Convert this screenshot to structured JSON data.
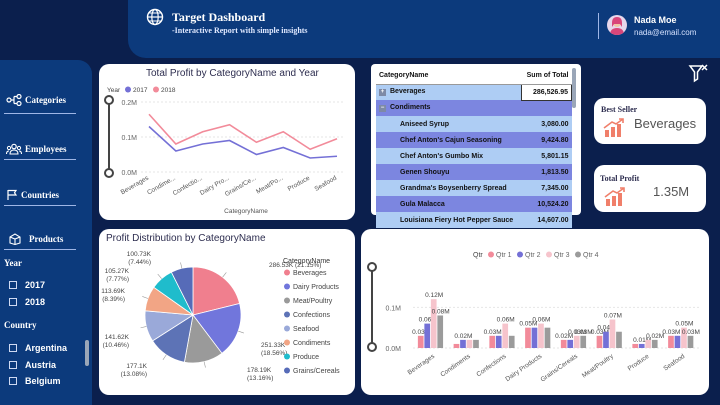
{
  "header": {
    "title": "Target Dashboard",
    "subtitle": "-Interactive Report with simple insights",
    "user_name": "Nada Moe",
    "user_email": "nada@email.com"
  },
  "sidebar": {
    "nav": [
      {
        "label": "Categories",
        "icon": "categories-icon"
      },
      {
        "label": "Employees",
        "icon": "employees-icon"
      },
      {
        "label": "Countries",
        "icon": "countries-icon"
      },
      {
        "label": "Products",
        "icon": "products-icon"
      }
    ],
    "year_label": "Year",
    "years": [
      "2017",
      "2018"
    ],
    "country_label": "Country",
    "countries": [
      "Argentina",
      "Austria",
      "Belgium"
    ]
  },
  "kpis": {
    "best_seller_label": "Best Seller",
    "best_seller_value": "Beverages",
    "total_profit_label": "Total Profit",
    "total_profit_value": "1.35M"
  },
  "matrix": {
    "col_category": "CategoryName",
    "col_total": "Sum of Total",
    "groups": [
      {
        "name": "Beverages",
        "value": "286,526.95",
        "collapsed": true
      },
      {
        "name": "Condiments",
        "value": "",
        "collapsed": false
      }
    ],
    "rows": [
      {
        "name": "Aniseed Syrup",
        "value": "3,080.00"
      },
      {
        "name": "Chef Anton's Cajun Seasoning",
        "value": "9,424.80"
      },
      {
        "name": "Chef Anton's Gumbo Mix",
        "value": "5,801.15"
      },
      {
        "name": "Genen Shouyu",
        "value": "1,813.50"
      },
      {
        "name": "Grandma's Boysenberry Spread",
        "value": "7,345.00"
      },
      {
        "name": "Gula Malacca",
        "value": "10,524.20"
      },
      {
        "name": "Louisiana Fiery Hot Pepper Sauce",
        "value": "14,607.00"
      }
    ]
  },
  "chart_data": [
    {
      "type": "line",
      "title": "Total Profit by CategoryName and Year",
      "legend_title": "Year",
      "legend_position": "top-left",
      "xlabel": "CategoryName",
      "ylabel": "",
      "ylim": [
        0,
        0.2
      ],
      "y_ticks": [
        "0.0M",
        "0.1M",
        "0.2M"
      ],
      "categories": [
        "Beverages",
        "Condime...",
        "Confectio...",
        "Dairy Pro...",
        "Grains/Ce...",
        "Meat/Po...",
        "Produce",
        "Seafood"
      ],
      "series": [
        {
          "name": "2017",
          "color": "#7470d6",
          "values": [
            0.13,
            0.06,
            0.08,
            0.09,
            0.05,
            0.07,
            0.04,
            0.045
          ]
        },
        {
          "name": "2018",
          "color": "#f28b9a",
          "values": [
            0.165,
            0.08,
            0.115,
            0.135,
            0.085,
            0.115,
            0.065,
            0.095
          ]
        }
      ]
    },
    {
      "type": "pie",
      "title": "Profit Distribution by CategoryName",
      "legend_title": "CategoryName",
      "legend_position": "right",
      "slices": [
        {
          "name": "Beverages",
          "value": 286.53,
          "label": "286.53K (21.15%)",
          "color": "#f07f8e"
        },
        {
          "name": "Dairy Products",
          "value": 251.33,
          "label": "251.33K (18.56%)",
          "color": "#7176dc"
        },
        {
          "name": "Meat/Poultry",
          "value": 178.19,
          "label": "178.19K (13.16%)",
          "color": "#9a9a9a"
        },
        {
          "name": "Confections",
          "value": 177.1,
          "label": "177.1K (13.08%)",
          "color": "#5d73b6"
        },
        {
          "name": "Seafood",
          "value": 141.62,
          "label": "141.62K (10.46%)",
          "color": "#9aa9d9"
        },
        {
          "name": "Condiments",
          "value": 113.69,
          "label": "113.69K (8.39%)",
          "color": "#f2a585"
        },
        {
          "name": "Produce",
          "value": 105.27,
          "label": "105.27K (7.77%)",
          "color": "#1fbccc"
        },
        {
          "name": "Grains/Cereals",
          "value": 100.73,
          "label": "100.73K (7.44%)",
          "color": "#566bb8"
        }
      ]
    },
    {
      "type": "bar",
      "title": "",
      "legend_title": "Qtr",
      "legend_position": "top",
      "ylim": [
        0,
        0.15
      ],
      "y_ticks": [
        "0.0M",
        "0.1M"
      ],
      "categories": [
        "Beverages",
        "Condiments",
        "Confections",
        "Dairy Products",
        "Grains/Cereals",
        "Meat/Poultry",
        "Produce",
        "Seafood"
      ],
      "series": [
        {
          "name": "Qtr 1",
          "color": "#f28b9a",
          "values": [
            0.03,
            0.01,
            0.03,
            0.05,
            0.02,
            0.03,
            0.01,
            0.03
          ],
          "labels": [
            "0.03M",
            "",
            "0.03M",
            "0.05M",
            "0.02M",
            "0.03M",
            "",
            "0.03M"
          ]
        },
        {
          "name": "Qtr 2",
          "color": "#7470d6",
          "values": [
            0.06,
            0.02,
            0.03,
            0.05,
            0.02,
            0.04,
            0.01,
            0.03
          ],
          "labels": [
            "0.06M",
            "0.02M",
            "",
            "",
            "",
            "0.04M",
            "0.01M",
            ""
          ]
        },
        {
          "name": "Qtr 3",
          "color": "#f6c4cc",
          "values": [
            0.12,
            0.02,
            0.06,
            0.06,
            0.03,
            0.07,
            0.02,
            0.05
          ],
          "labels": [
            "0.12M",
            "",
            "0.06M",
            "0.06M",
            "0.03M",
            "0.07M",
            "",
            "0.05M"
          ]
        },
        {
          "name": "Qtr 4",
          "color": "#9b9b9b",
          "values": [
            0.08,
            0.02,
            0.03,
            0.05,
            0.03,
            0.04,
            0.02,
            0.03
          ],
          "labels": [
            "0.08M",
            "",
            "",
            "",
            "0.03M",
            "",
            "0.02M",
            "0.03M"
          ]
        }
      ]
    }
  ]
}
